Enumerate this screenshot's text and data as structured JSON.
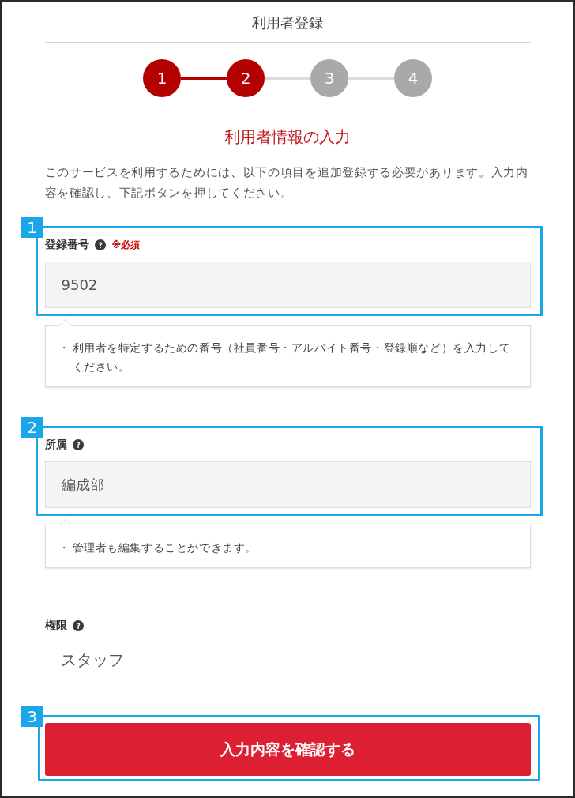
{
  "title": "利用者登録",
  "steps": [
    {
      "number": "1",
      "active": true
    },
    {
      "number": "2",
      "active": true
    },
    {
      "number": "3",
      "active": false
    },
    {
      "number": "4",
      "active": false
    }
  ],
  "heading": "利用者情報の入力",
  "intro": "このサービスを利用するためには、以下の項目を追加登録する必要があります。入力内容を確認し、下記ボタンを押してください。",
  "fields": [
    {
      "kind": "input",
      "label": "登録番号",
      "required_mark": "※必須",
      "value": "9502",
      "help": {
        "bullet": "・",
        "text": "利用者を特定するための番号（社員番号・アルバイト番号・登録順など）を入力してください。"
      },
      "callout": "1"
    },
    {
      "kind": "input",
      "label": "所属",
      "value": "編成部",
      "help": {
        "bullet": "・",
        "text": "管理者も編集することができます。"
      },
      "callout": "2"
    },
    {
      "kind": "text",
      "label": "権限",
      "value": "スタッフ"
    }
  ],
  "submit": {
    "label": "入力内容を確認する",
    "callout": "3"
  }
}
